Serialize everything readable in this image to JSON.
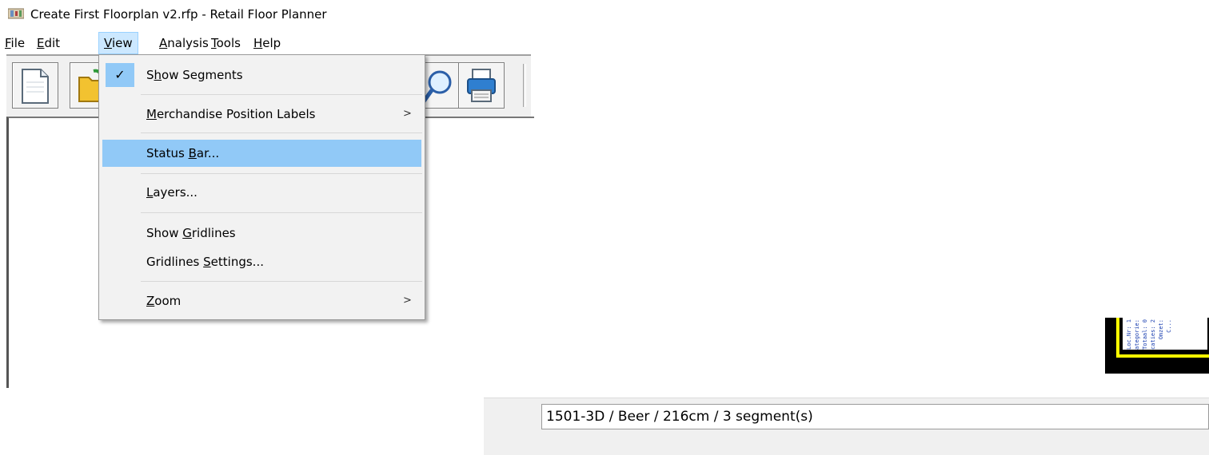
{
  "window": {
    "title": "Create First Floorplan v2.rfp - Retail Floor Planner"
  },
  "menubar": {
    "items": [
      {
        "label_pre": "",
        "accel": "F",
        "label_post": "ile"
      },
      {
        "label_pre": "",
        "accel": "E",
        "label_post": "dit"
      },
      {
        "label_pre": "",
        "accel": "V",
        "label_post": "iew"
      },
      {
        "label_pre": "",
        "accel": "A",
        "label_post": "nalysis"
      },
      {
        "label_pre": "",
        "accel": "T",
        "label_post": "ools"
      },
      {
        "label_pre": "",
        "accel": "H",
        "label_post": "elp"
      }
    ]
  },
  "view_menu": {
    "show_segments": {
      "pre": "S",
      "accel": "h",
      "post": "ow Segments",
      "checked": true,
      "check_glyph": "✓"
    },
    "merch_labels": {
      "pre": "",
      "accel": "M",
      "post": "erchandise Position Labels",
      "arrow": ">"
    },
    "status_bar": {
      "pre": "Status ",
      "accel": "B",
      "post": "ar..."
    },
    "layers": {
      "pre": "",
      "accel": "L",
      "post": "ayers..."
    },
    "show_gridlines": {
      "pre": "Show ",
      "accel": "G",
      "post": "ridlines"
    },
    "gridlines_settings": {
      "pre": "Gridlines ",
      "accel": "S",
      "post": "ettings..."
    },
    "zoom": {
      "pre": "",
      "accel": "Z",
      "post": "oom",
      "arrow": ">"
    }
  },
  "toolbar": {
    "buttons": [
      "new-file-icon",
      "open-folder-icon",
      "zoom-magnifier-icon",
      "print-icon"
    ]
  },
  "plan_fragment": {
    "lines": [
      "Loc.Nr: 1",
      "Categorie:",
      "Totaal: 0",
      "Locaties: 2",
      "Omzet:",
      "C..."
    ]
  },
  "statusbar": {
    "text": "1501-3D / Beer / 216cm / 3 segment(s)"
  },
  "colors": {
    "menu_highlight": "#91c9f7",
    "menubar_active": "#cce8ff",
    "plan_yellow": "#ffff00",
    "plan_text": "#1a3fb0"
  }
}
